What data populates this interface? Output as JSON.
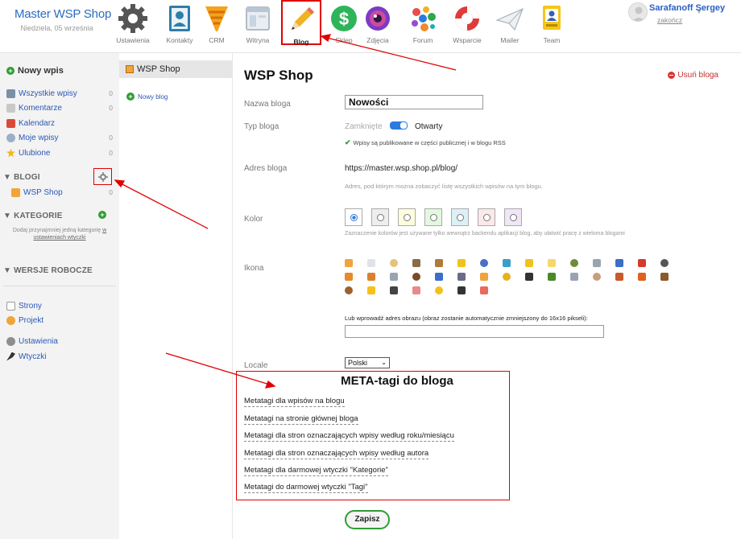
{
  "brand": {
    "title": "Master WSP Shop",
    "date": "Niedziela, 05 września"
  },
  "apps": [
    {
      "label": "Ustawienia",
      "icon": "gear-icon"
    },
    {
      "label": "Kontakty",
      "icon": "contacts-book-icon"
    },
    {
      "label": "CRM",
      "icon": "funnel-icon"
    },
    {
      "label": "Witryna",
      "icon": "browser-window-icon"
    },
    {
      "label": "Blog",
      "icon": "pencil-icon",
      "active": true
    },
    {
      "label": "Sklep",
      "icon": "dollar-icon"
    },
    {
      "label": "Zdjęcia",
      "icon": "camera-lens-icon"
    },
    {
      "label": "Forum",
      "icon": "colorful-bubbles-icon"
    },
    {
      "label": "Wsparcie",
      "icon": "lifebuoy-icon"
    },
    {
      "label": "Mailer",
      "icon": "paper-plane-icon"
    },
    {
      "label": "Team",
      "icon": "id-badge-icon"
    }
  ],
  "user": {
    "name": "Sarafanoff Sergey",
    "logout": "zakończ"
  },
  "sidebar": {
    "new_post": "Nowy wpis",
    "items": [
      {
        "label": "Wszystkie wpisy",
        "count": "0"
      },
      {
        "label": "Komentarze",
        "count": "0"
      },
      {
        "label": "Kalendarz",
        "count": ""
      },
      {
        "label": "Moje wpisy",
        "count": "0"
      },
      {
        "label": "Ulubione",
        "count": "0"
      }
    ],
    "blogs_title": "▼ BLOGI",
    "blog_item": {
      "label": "WSP Shop",
      "count": "0"
    },
    "categories_title": "▼ KATEGORIE",
    "categories_note": "Dodaj przynajmniej jedną kategorię",
    "categories_link": "w ustawieniach wtyczki",
    "drafts_title": "▼ WERSJE ROBOCZE",
    "bottom": [
      {
        "label": "Strony"
      },
      {
        "label": "Projekt"
      },
      {
        "label": "Ustawienia"
      },
      {
        "label": "Wtyczki"
      }
    ]
  },
  "col2": {
    "blog_name": "WSP Shop",
    "new_blog": "Nowy blog"
  },
  "main": {
    "title": "WSP Shop",
    "delete": "Usuń bloga",
    "name_label": "Nazwa bloga",
    "name_value": "Nowości",
    "type_label": "Typ bloga",
    "type_closed": "Zamknięte",
    "type_open": "Otwarty",
    "type_note": "Wpisy są publikowane w części publicznej i w blogu RSS",
    "address_label": "Adres bloga",
    "address_value": "https://master.wsp.shop.pl/blog/",
    "address_hint": "Adres, pod którym można zobaczyć listę wszystkich wpisów na tym blogu.",
    "color_label": "Kolor",
    "color_hint": "Zaznaczenie kolorów jest używane tylko wewnątrz backendu aplikacji blog, aby ułatwić pracę z wieloma blogami",
    "colors": [
      "#ffffff",
      "#eeeeee",
      "#fdfde0",
      "#e4f8e0",
      "#dcf0f8",
      "#fbe8e8",
      "#f0e6f8"
    ],
    "icon_label": "Ikona",
    "icon_url_label": "Lub wprowadź adres obrazu (obraz zostanie automatycznie zmniejszony do 16x16 pikseli):",
    "locale_label": "Locale",
    "locale_value": "Polski",
    "meta_title": "META-tagi do bloga",
    "meta_links": [
      "Metatagi dla wpisów na blogu",
      "Metatagi na stronie głównej bloga",
      "Metatagi dla stron oznaczających wpisy według roku/miesiącu",
      "Metatagi dla stron oznaczających wpisy według autora",
      "Metatagi dla darmowej wtyczki \"Kategorie\"",
      "Metatagi do darmowej wtyczki \"Tagi\""
    ],
    "save": "Zapisz"
  }
}
